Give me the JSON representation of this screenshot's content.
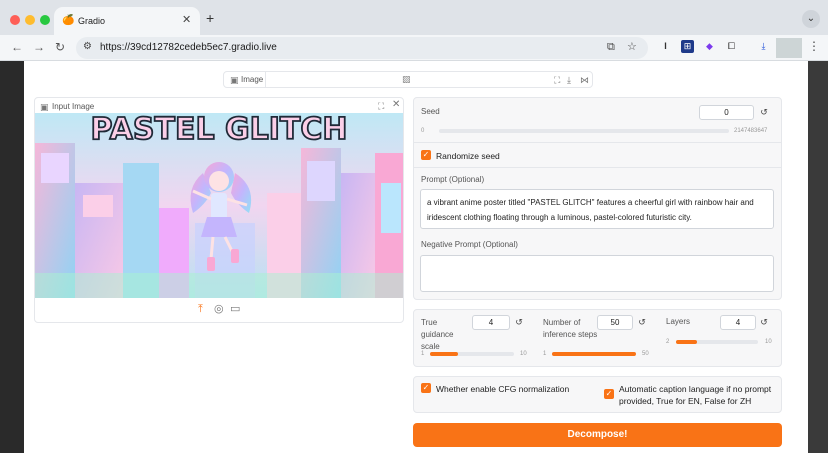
{
  "browser": {
    "tab_title": "Gradio",
    "tab_favicon": "gradio-favicon",
    "url": "https://39cd12782cedeb5ec7.gradio.live",
    "new_tab_label": "+"
  },
  "output_image": {
    "label": "Image"
  },
  "input_image": {
    "label": "Input Image",
    "poster_title": "PASTEL GLITCH"
  },
  "seed": {
    "label": "Seed",
    "value": "0",
    "min": "0",
    "max": "2147483647"
  },
  "randomize_seed": {
    "label": "Randomize seed",
    "checked": true
  },
  "prompt": {
    "label": "Prompt (Optional)",
    "value": "a vibrant anime poster titled \"PASTEL GLITCH\" features a cheerful girl with rainbow hair and iridescent clothing floating through a luminous, pastel-colored futuristic city."
  },
  "negative_prompt": {
    "label": "Negative Prompt (Optional)",
    "value": ""
  },
  "guidance": {
    "label": "True guidance scale",
    "value": "4",
    "min": "1",
    "max": "10",
    "fraction": 0.33
  },
  "steps": {
    "label": "Number of inference steps",
    "value": "50",
    "min": "1",
    "max": "50",
    "fraction": 1.0
  },
  "layers": {
    "label": "Layers",
    "value": "4",
    "min": "2",
    "max": "10",
    "fraction": 0.25
  },
  "cfg_norm": {
    "label": "Whether enable CFG normalization",
    "checked": true
  },
  "caption_lang": {
    "label": "Automatic caption language if no prompt provided, True for EN, False for ZH",
    "checked": true
  },
  "submit": {
    "label": "Decompose!"
  },
  "colors": {
    "accent": "#f97316",
    "page_bg": "#ffffff",
    "chrome_bg": "#dfe3e8"
  }
}
